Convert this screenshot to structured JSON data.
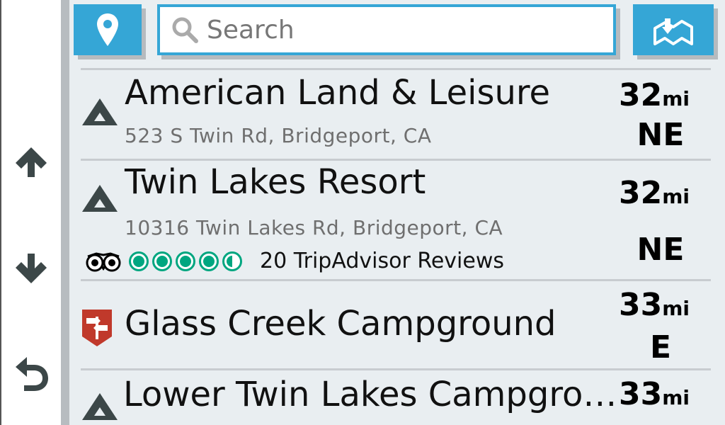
{
  "nav": {
    "up_icon": "arrow-up-icon",
    "down_icon": "arrow-down-icon",
    "back_icon": "back-arrow-icon"
  },
  "topbar": {
    "location_icon": "map-pin-icon",
    "search": {
      "placeholder": "Search",
      "icon": "search-icon"
    },
    "map_icon": "map-view-icon"
  },
  "results": [
    {
      "name": "American Land & Leisure",
      "address": "523 S Twin Rd, Bridgeport, CA",
      "distance": "32",
      "unit": "mi",
      "direction": "NE",
      "icon": "campground-tent-icon"
    },
    {
      "name": "Twin Lakes Resort",
      "address": "10316 Twin Lakes Rd, Bridgeport, CA",
      "distance": "32",
      "unit": "mi",
      "direction": "NE",
      "icon": "campground-tent-icon",
      "reviews": {
        "text": "20 TripAdvisor Reviews",
        "rating": 4.5,
        "logo": "tripadvisor-owl-icon"
      }
    },
    {
      "name": "Glass Creek Campground",
      "address": "",
      "distance": "33",
      "unit": "mi",
      "direction": "E",
      "icon": "trail-signpost-icon"
    },
    {
      "name": "Lower Twin Lakes Campgro…",
      "address": "",
      "distance": "33",
      "unit": "mi",
      "direction": "",
      "icon": "campground-tent-icon"
    }
  ],
  "colors": {
    "accent": "#35a6d6",
    "rating": "#00a680",
    "list_bg": "#e9eef1",
    "icon_dark": "#3c4748",
    "sign_badge": "#c0392b"
  }
}
